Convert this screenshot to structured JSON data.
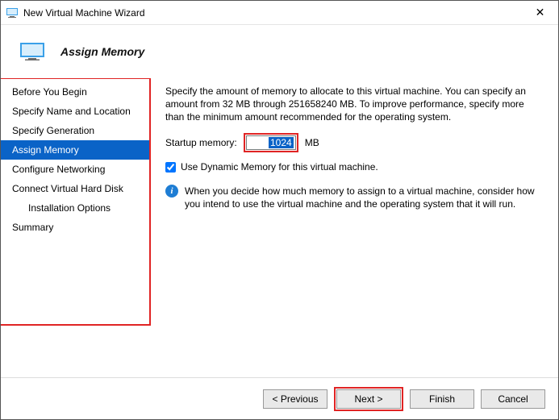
{
  "window": {
    "title": "New Virtual Machine Wizard"
  },
  "hero": {
    "heading": "Assign Memory"
  },
  "sidebar": {
    "items": [
      {
        "label": "Before You Begin",
        "selected": false,
        "indent": false
      },
      {
        "label": "Specify Name and Location",
        "selected": false,
        "indent": false
      },
      {
        "label": "Specify Generation",
        "selected": false,
        "indent": false
      },
      {
        "label": "Assign Memory",
        "selected": true,
        "indent": false
      },
      {
        "label": "Configure Networking",
        "selected": false,
        "indent": false
      },
      {
        "label": "Connect Virtual Hard Disk",
        "selected": false,
        "indent": false
      },
      {
        "label": "Installation Options",
        "selected": false,
        "indent": true
      },
      {
        "label": "Summary",
        "selected": false,
        "indent": false
      }
    ]
  },
  "content": {
    "intro": "Specify the amount of memory to allocate to this virtual machine. You can specify an amount from 32 MB through 251658240 MB. To improve performance, specify more than the minimum amount recommended for the operating system.",
    "startup_label": "Startup memory:",
    "startup_value": "1024",
    "unit": "MB",
    "dynamic_checked": true,
    "dynamic_label": "Use Dynamic Memory for this virtual machine.",
    "info": "When you decide how much memory to assign to a virtual machine, consider how you intend to use the virtual machine and the operating system that it will run."
  },
  "footer": {
    "previous": "< Previous",
    "next": "Next >",
    "finish": "Finish",
    "cancel": "Cancel"
  }
}
